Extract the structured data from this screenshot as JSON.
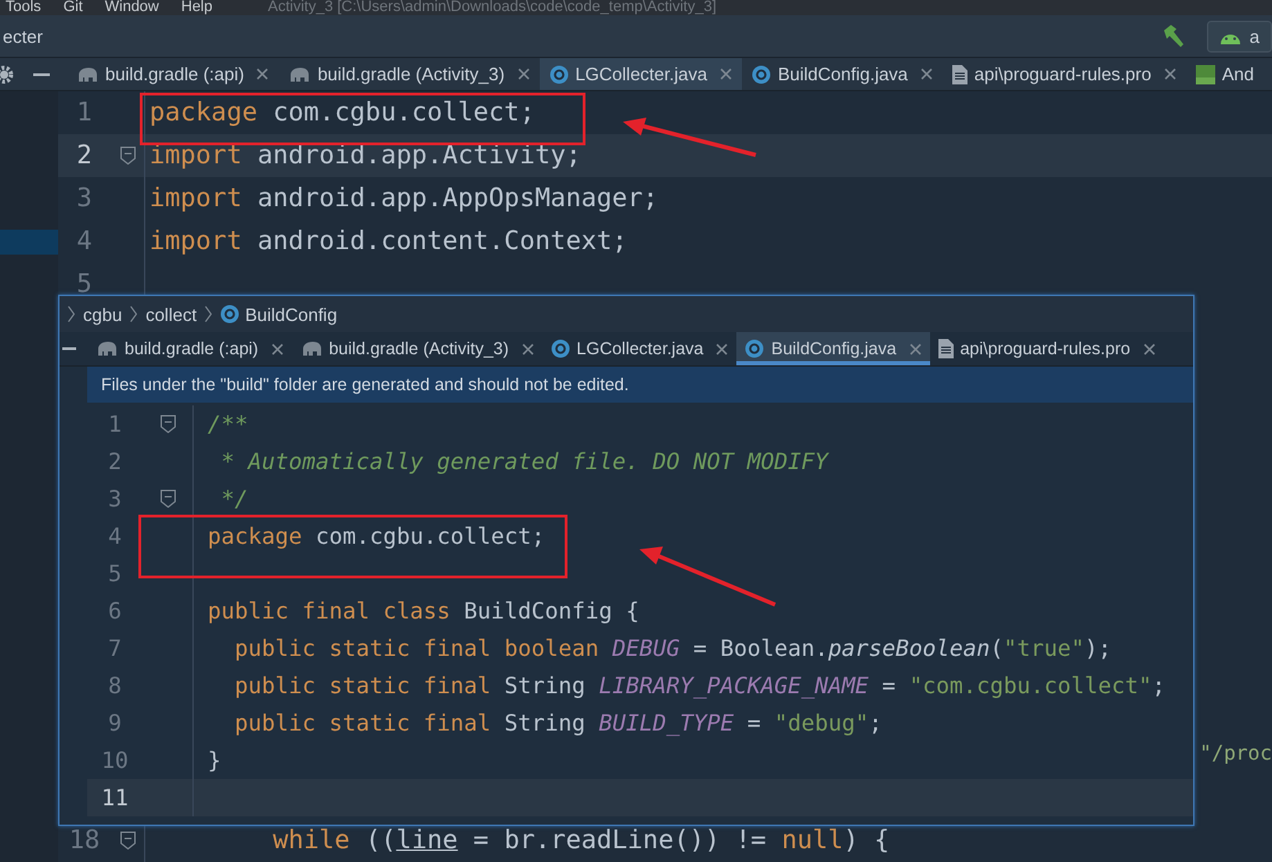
{
  "menu": [
    "Tools",
    "Git",
    "Window",
    "Help"
  ],
  "title": "Activity_3 [C:\\Users\\admin\\Downloads\\code\\code_temp\\Activity_3]",
  "toolbar": {
    "file_label": "ecter",
    "run_config": "a"
  },
  "tabs": [
    {
      "label": "build.gradle (:api)",
      "kind": "gradle",
      "selected": false
    },
    {
      "label": "build.gradle (Activity_3)",
      "kind": "gradle",
      "selected": false
    },
    {
      "label": "LGCollecter.java",
      "kind": "class",
      "selected": true
    },
    {
      "label": "BuildConfig.java",
      "kind": "class",
      "selected": false
    },
    {
      "label": "api\\proguard-rules.pro",
      "kind": "file",
      "selected": false
    },
    {
      "label": "And",
      "kind": "manifest",
      "selected": false
    }
  ],
  "editor": {
    "lines": [
      {
        "number": "1",
        "current": false,
        "fold": false,
        "tokens": [
          {
            "t": "package ",
            "kind": "keyword"
          },
          {
            "t": "com.cgbu.collect;",
            "kind": "plain"
          }
        ]
      },
      {
        "number": "2",
        "current": true,
        "fold": true,
        "tokens": [
          {
            "t": "import ",
            "kind": "keyword"
          },
          {
            "t": "android.app.Activity;",
            "kind": "plain"
          }
        ]
      },
      {
        "number": "3",
        "current": false,
        "fold": false,
        "tokens": [
          {
            "t": "import ",
            "kind": "keyword"
          },
          {
            "t": "android.app.AppOpsManager;",
            "kind": "plain"
          }
        ]
      },
      {
        "number": "4",
        "current": false,
        "fold": false,
        "tokens": [
          {
            "t": "import ",
            "kind": "keyword"
          },
          {
            "t": "android.content.Context;",
            "kind": "plain"
          }
        ]
      },
      {
        "number": "5",
        "current": false,
        "fold": false
      }
    ],
    "right_fragment": "\"/proc",
    "bottom_line": {
      "number": "18",
      "current": false,
      "fold": true,
      "tokens": [
        {
          "t": "        while ",
          "kind": "keyword"
        },
        {
          "t": "((",
          "kind": "plain"
        },
        {
          "t": "line",
          "kind": "variable"
        },
        {
          "t": " = br.readLine()) != ",
          "kind": "plain"
        },
        {
          "t": "null",
          "kind": "keyword"
        },
        {
          "t": ") {",
          "kind": "plain"
        }
      ]
    }
  },
  "popup": {
    "breadcrumb": [
      "cgbu",
      "collect",
      "BuildConfig"
    ],
    "tabs": [
      {
        "label": "build.gradle (:api)",
        "kind": "gradle",
        "selected": false
      },
      {
        "label": "build.gradle (Activity_3)",
        "kind": "gradle",
        "selected": false
      },
      {
        "label": "LGCollecter.java",
        "kind": "class",
        "selected": false
      },
      {
        "label": "BuildConfig.java",
        "kind": "class",
        "selected": true
      },
      {
        "label": "api\\proguard-rules.pro",
        "kind": "file",
        "selected": false
      }
    ],
    "notice": "Files under the \"build\" folder are generated and should not be edited.",
    "lines": [
      {
        "number": "1",
        "current": false,
        "fold": true,
        "tokens": [
          {
            "t": "/**",
            "kind": "comment"
          }
        ]
      },
      {
        "number": "2",
        "current": false,
        "fold": false,
        "tokens": [
          {
            "t": " * Automatically generated file. DO NOT MODIFY",
            "kind": "comment"
          }
        ]
      },
      {
        "number": "3",
        "current": false,
        "fold": true,
        "tokens": [
          {
            "t": " */",
            "kind": "comment"
          }
        ]
      },
      {
        "number": "4",
        "current": false,
        "fold": false,
        "tokens": [
          {
            "t": "package ",
            "kind": "keyword"
          },
          {
            "t": "com.cgbu.collect;",
            "kind": "plain"
          }
        ]
      },
      {
        "number": "5",
        "current": false,
        "fold": false
      },
      {
        "number": "6",
        "current": false,
        "fold": false,
        "tokens": [
          {
            "t": "public final class ",
            "kind": "keyword"
          },
          {
            "t": "BuildConfig {",
            "kind": "plain"
          }
        ]
      },
      {
        "number": "7",
        "current": false,
        "fold": false,
        "tokens": [
          {
            "t": "  public static final boolean ",
            "kind": "keyword"
          },
          {
            "t": "DEBUG",
            "kind": "field"
          },
          {
            "t": " = Boolean.",
            "kind": "plain"
          },
          {
            "t": "parseBoolean",
            "kind": "method"
          },
          {
            "t": "(",
            "kind": "plain"
          },
          {
            "t": "\"true\"",
            "kind": "string"
          },
          {
            "t": ");",
            "kind": "plain"
          }
        ]
      },
      {
        "number": "8",
        "current": false,
        "fold": false,
        "tokens": [
          {
            "t": "  public static final ",
            "kind": "keyword"
          },
          {
            "t": "String ",
            "kind": "plain"
          },
          {
            "t": "LIBRARY_PACKAGE_NAME",
            "kind": "field"
          },
          {
            "t": " = ",
            "kind": "plain"
          },
          {
            "t": "\"com.cgbu.collect\"",
            "kind": "string"
          },
          {
            "t": ";",
            "kind": "plain"
          }
        ]
      },
      {
        "number": "9",
        "current": false,
        "fold": false,
        "tokens": [
          {
            "t": "  public static final ",
            "kind": "keyword"
          },
          {
            "t": "String ",
            "kind": "plain"
          },
          {
            "t": "BUILD_TYPE",
            "kind": "field"
          },
          {
            "t": " = ",
            "kind": "plain"
          },
          {
            "t": "\"debug\"",
            "kind": "string"
          },
          {
            "t": ";",
            "kind": "plain"
          }
        ]
      },
      {
        "number": "10",
        "current": false,
        "fold": false,
        "tokens": [
          {
            "t": "}",
            "kind": "plain"
          }
        ]
      },
      {
        "number": "11",
        "current": true,
        "fold": false
      }
    ]
  }
}
